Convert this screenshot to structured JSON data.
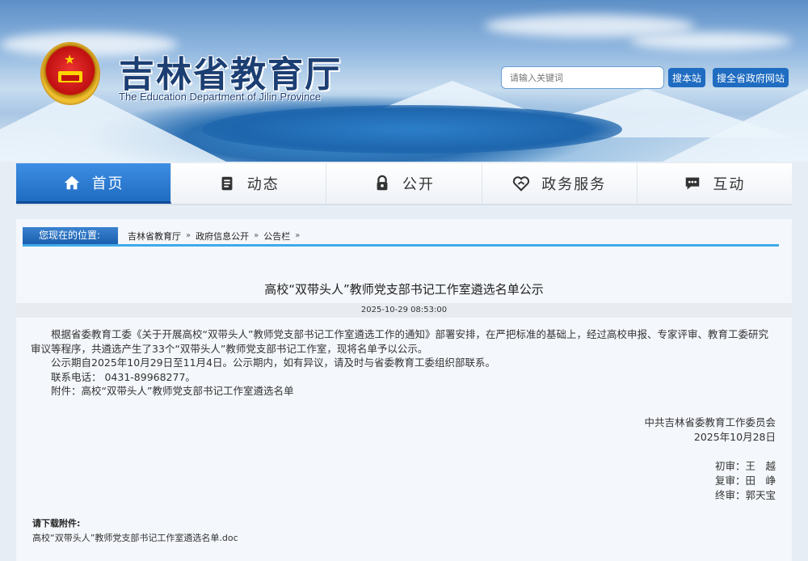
{
  "header": {
    "site_title": "吉林省教育厅",
    "site_subtitle": "The Education Department of Jilin Province",
    "emblem_icon": "national-emblem-icon",
    "search_placeholder": "请输入关键词",
    "search_site_label": "搜本站",
    "search_gov_label": "搜全省政府网站"
  },
  "nav": {
    "items": [
      {
        "label": "首页",
        "icon": "home-icon",
        "active": true
      },
      {
        "label": "动态",
        "icon": "book-icon",
        "active": false
      },
      {
        "label": "公开",
        "icon": "lock-icon",
        "active": false
      },
      {
        "label": "政务服务",
        "icon": "heart-hands-icon",
        "active": false
      },
      {
        "label": "互动",
        "icon": "chat-icon",
        "active": false
      }
    ],
    "active_color": "#1f6cc1"
  },
  "breadcrumb": {
    "label": "您现在的位置:",
    "items": [
      "吉林省教育厅",
      "政府信息公开",
      "公告栏"
    ],
    "separator": "»"
  },
  "article": {
    "title": "高校“双带头人”教师党支部书记工作室遴选名单公示",
    "date": "2025-10-29 08:53:00",
    "paragraph_1": "根据省委教育工委《关于开展高校“双带头人”教师党支部书记工作室遴选工作的通知》部署安排，在严把标准的基础上，经过高校申报、专家评审、教育工委研究审议等程序，共遴选产生了33个“双带头人”教师党支部书记工作室，现将名单予以公示。",
    "paragraph_2": "公示期自2025年10月29日至11月4日。公示期内，如有异议，请及时与省委教育工委组织部联系。",
    "paragraph_3": "联系电话： 0431-89968277。",
    "paragraph_4": "附件：高校“双带头人”教师党支部书记工作室遴选名单",
    "issuer": "中共吉林省委教育工作委员会",
    "issue_date": "2025年10月28日",
    "reviewer_1": "初审：王　越",
    "reviewer_2": "复审：田　峥",
    "reviewer_3": "终审：郭天宝"
  },
  "downloads": {
    "label": "请下载附件:",
    "file": "高校“双带头人”教师党支部书记工作室遴选名单.doc"
  }
}
